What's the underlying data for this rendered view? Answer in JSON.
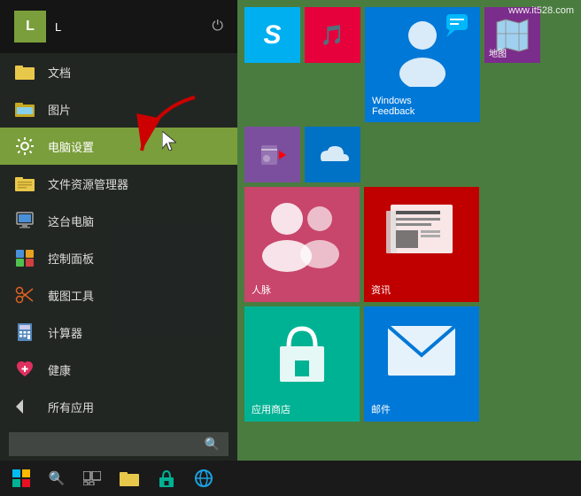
{
  "watermark": "www.it528.com",
  "user": {
    "initial": "L",
    "name": "L"
  },
  "left_panel": {
    "menu_items": [
      {
        "id": "docs",
        "label": "文档",
        "icon": "folder"
      },
      {
        "id": "pics",
        "label": "图片",
        "icon": "folder-image"
      },
      {
        "id": "settings",
        "label": "电脑设置",
        "icon": "settings",
        "active": true
      },
      {
        "id": "explorer",
        "label": "文件资源管理器",
        "icon": "folder"
      },
      {
        "id": "thispc",
        "label": "这台电脑",
        "icon": "computer"
      },
      {
        "id": "controlpanel",
        "label": "控制面板",
        "icon": "control"
      },
      {
        "id": "snipping",
        "label": "截图工具",
        "icon": "scissors"
      },
      {
        "id": "calc",
        "label": "计算器",
        "icon": "calc"
      },
      {
        "id": "health",
        "label": "健康",
        "icon": "heart"
      }
    ],
    "all_apps": "所有应用",
    "search_placeholder": ""
  },
  "tiles": [
    {
      "id": "skype",
      "label": "",
      "color": "#00aff0",
      "size": "sm",
      "icon": "S"
    },
    {
      "id": "music",
      "label": "",
      "color": "#e6003c",
      "size": "sm",
      "icon": "♫"
    },
    {
      "id": "feedback",
      "label": "Windows\nFeedback",
      "color": "#0078d7",
      "size": "md",
      "icon": "person"
    },
    {
      "id": "video",
      "label": "",
      "color": "#7b2d8b",
      "size": "sm",
      "icon": "▶"
    },
    {
      "id": "onedrive",
      "label": "",
      "color": "#0072c6",
      "size": "sm",
      "icon": "☁"
    },
    {
      "id": "maps",
      "label": "地图",
      "color": "#7b2d8b",
      "size": "sm-label",
      "icon": "🗺"
    },
    {
      "id": "people",
      "label": "人脉",
      "color": "#c8456c",
      "size": "md",
      "icon": "people"
    },
    {
      "id": "news",
      "label": "资讯",
      "color": "#c00000",
      "size": "md",
      "icon": "news"
    },
    {
      "id": "store",
      "label": "应用商店",
      "color": "#00b294",
      "size": "md",
      "icon": "store"
    },
    {
      "id": "mail",
      "label": "邮件",
      "color": "#0078d7",
      "size": "md",
      "icon": "mail"
    }
  ],
  "taskbar": {
    "start_icon": "⊞",
    "search_icon": "🔍",
    "apps": [
      "⊞",
      "🔍",
      "▢",
      "📁",
      "🛍",
      "🌐"
    ]
  }
}
